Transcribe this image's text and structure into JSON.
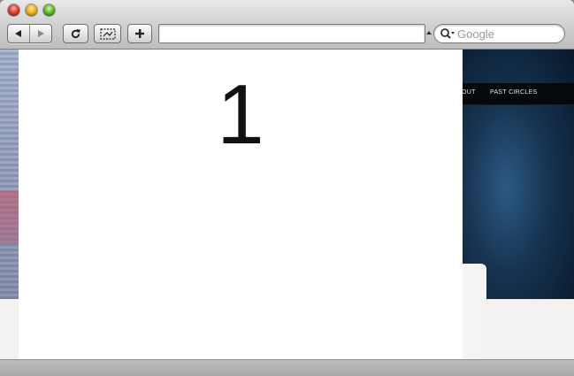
{
  "browser": {
    "search": {
      "placeholder": "Google"
    }
  },
  "page": {
    "nav": [
      "OUT",
      "PAST CIRCLES"
    ],
    "overlay_number": "1"
  },
  "icons": {
    "back": "back-arrow-icon",
    "forward": "forward-arrow-icon",
    "reload": "reload-icon",
    "snap": "webclip-icon",
    "add": "plus-icon",
    "search": "magnifier-icon"
  },
  "colors": {
    "close": "#e2402e",
    "minimize": "#f0b322",
    "zoom": "#62be2d",
    "page_dark": "#163350"
  }
}
